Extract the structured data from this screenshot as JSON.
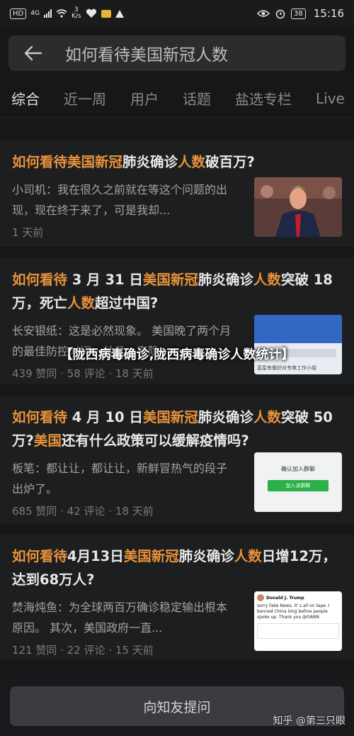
{
  "status_bar": {
    "network_badge": "HD",
    "network_type": "4G",
    "speed_value": "3",
    "speed_unit": "K/s",
    "battery": "38",
    "time": "15:16"
  },
  "search": {
    "query": "如何看待美国新冠人数"
  },
  "tabs": [
    {
      "label": "综合",
      "active": true
    },
    {
      "label": "近一周",
      "active": false
    },
    {
      "label": "用户",
      "active": false
    },
    {
      "label": "话题",
      "active": false
    },
    {
      "label": "盐选专栏",
      "active": false
    },
    {
      "label": "Live",
      "active": false
    }
  ],
  "results": [
    {
      "title_parts": [
        {
          "text": "如何看待美国新冠",
          "hl": true
        },
        {
          "text": "肺炎确诊",
          "hl": false
        },
        {
          "text": "人数",
          "hl": true
        },
        {
          "text": "破百万?",
          "hl": false
        }
      ],
      "excerpt": "小司机：我在很久之前就在等这个问题的出现，现在终于来了，可是我却...",
      "meta": "1 天前"
    },
    {
      "title_parts": [
        {
          "text": "如何看待",
          "hl": true
        },
        {
          "text": " 3 月 31 日",
          "hl": false
        },
        {
          "text": "美国新冠",
          "hl": true
        },
        {
          "text": "肺炎确诊",
          "hl": false
        },
        {
          "text": "人数",
          "hl": true
        },
        {
          "text": "突破 18 万，死亡",
          "hl": false
        },
        {
          "text": "人数",
          "hl": true
        },
        {
          "text": "超过中国?",
          "hl": false
        }
      ],
      "excerpt": "长安银纸：这是必然现象。 美国晚了两个月的最佳防控时间，并且一直隐...",
      "meta": "439 赞同 · 58 评论 · 18 天前",
      "thumb_text": [
        "蓝星有做好对专席工作小组"
      ]
    },
    {
      "title_parts": [
        {
          "text": "如何看待",
          "hl": true
        },
        {
          "text": " 4 月 10 日",
          "hl": false
        },
        {
          "text": "美国新冠",
          "hl": true
        },
        {
          "text": "肺炎确诊",
          "hl": false
        },
        {
          "text": "人数",
          "hl": true
        },
        {
          "text": "突破 50万?",
          "hl": false
        },
        {
          "text": "美国",
          "hl": true
        },
        {
          "text": "还有什么政策可以缓解疫情吗?",
          "hl": false
        }
      ],
      "excerpt": "板笔：都让让，都让让，新鲜冒热气的段子出炉了。",
      "meta": "685 赞同 · 42 评论 · 18 天前",
      "thumb_text": [
        "确认加入群聊",
        "加入该群聊"
      ]
    },
    {
      "title_parts": [
        {
          "text": "如何看待",
          "hl": true
        },
        {
          "text": "4月13日",
          "hl": false
        },
        {
          "text": "美国新冠",
          "hl": true
        },
        {
          "text": "肺炎确诊",
          "hl": false
        },
        {
          "text": "人数",
          "hl": true
        },
        {
          "text": "日增12万，达到68万人?",
          "hl": false
        }
      ],
      "excerpt": "焚海炖鱼：为全球两百万确诊稳定输出根本原因。 其次，美国政府一直...",
      "meta": "121 赞同 · 22 评论 · 15 天前",
      "thumb_text": [
        "Donald J. Trump",
        "sorry Fake News, it' s all on tape. I banned China long before people spoke up. Thank you @OANN"
      ]
    }
  ],
  "overlay_title": "【陇西病毒确诊,陇西病毒确诊人数统计】",
  "ask_button": "向知友提问",
  "watermark": "知乎 @第三只眼",
  "colors": {
    "highlight": "#e8923a",
    "background": "#161718",
    "card": "#1d1e20"
  }
}
